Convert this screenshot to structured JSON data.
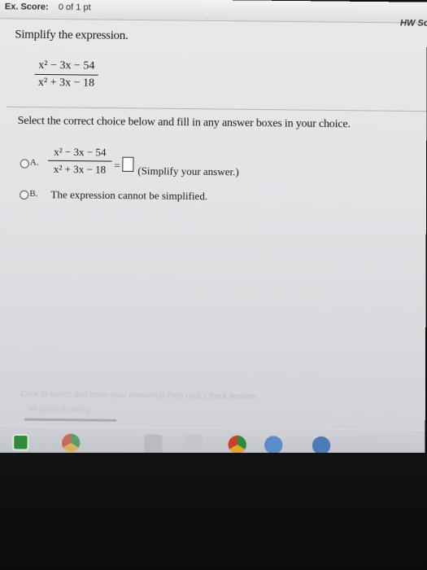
{
  "header": {
    "score_label": "Ex. Score:",
    "score_value": "0 of 1 pt",
    "hw_score": "HW Sc"
  },
  "question": {
    "instruction": "Simplify the expression.",
    "numerator": "x² − 3x − 54",
    "denominator": "x² + 3x − 18"
  },
  "select_text": "Select the correct choice below and fill in any answer boxes in your choice.",
  "choices": [
    {
      "letter": "A.",
      "numerator": "x² − 3x − 54",
      "denominator": "x² + 3x − 18",
      "equals": "=",
      "hint": "(Simplify your answer.)"
    },
    {
      "letter": "B.",
      "text": "The expression cannot be simplified."
    }
  ],
  "footer": {
    "hint": "Click to select and enter your answer(s) then click Check Answer.",
    "parts_showing": "All parts showing"
  },
  "taskbar": {
    "icons": [
      "start-icon",
      "chrome-icon",
      "app-icon",
      "app-icon",
      "app-icon",
      "chrome-icon",
      "ie-icon",
      "app-icon"
    ]
  }
}
